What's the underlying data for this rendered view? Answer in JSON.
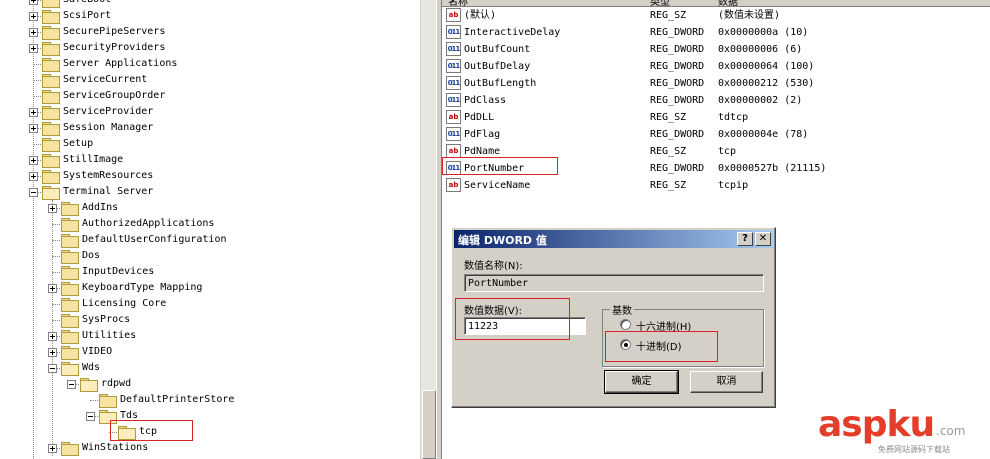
{
  "tree": {
    "nodes": [
      {
        "label": "SafeBoot",
        "expander": "plus"
      },
      {
        "label": "ScsiPort",
        "expander": "plus"
      },
      {
        "label": "SecurePipeServers",
        "expander": "plus"
      },
      {
        "label": "SecurityProviders",
        "expander": "plus"
      },
      {
        "label": "Server Applications",
        "expander": "none"
      },
      {
        "label": "ServiceCurrent",
        "expander": "none"
      },
      {
        "label": "ServiceGroupOrder",
        "expander": "none"
      },
      {
        "label": "ServiceProvider",
        "expander": "plus"
      },
      {
        "label": "Session Manager",
        "expander": "plus"
      },
      {
        "label": "Setup",
        "expander": "none"
      },
      {
        "label": "StillImage",
        "expander": "plus"
      },
      {
        "label": "SystemResources",
        "expander": "plus"
      },
      {
        "label": "Terminal Server",
        "expander": "minus"
      },
      {
        "label": "AddIns",
        "expander": "plus"
      },
      {
        "label": "AuthorizedApplications",
        "expander": "none"
      },
      {
        "label": "DefaultUserConfiguration",
        "expander": "none"
      },
      {
        "label": "Dos",
        "expander": "none"
      },
      {
        "label": "InputDevices",
        "expander": "none"
      },
      {
        "label": "KeyboardType Mapping",
        "expander": "plus"
      },
      {
        "label": "Licensing Core",
        "expander": "none"
      },
      {
        "label": "SysProcs",
        "expander": "none"
      },
      {
        "label": "Utilities",
        "expander": "plus"
      },
      {
        "label": "VIDEO",
        "expander": "plus"
      },
      {
        "label": "Wds",
        "expander": "minus"
      },
      {
        "label": "rdpwd",
        "expander": "minus"
      },
      {
        "label": "DefaultPrinterStore",
        "expander": "none"
      },
      {
        "label": "Tds",
        "expander": "minus"
      },
      {
        "label": "tcp",
        "expander": "none",
        "selected": true
      },
      {
        "label": "WinStations",
        "expander": "plus"
      }
    ]
  },
  "list": {
    "headers": {
      "name": "名称",
      "type": "类型",
      "data": "数据"
    },
    "rows": [
      {
        "icon": "string-value-icon",
        "name": "(默认)",
        "type": "REG_SZ",
        "data": "(数值未设置)"
      },
      {
        "icon": "binary-value-icon",
        "name": "InteractiveDelay",
        "type": "REG_DWORD",
        "data": "0x0000000a (10)"
      },
      {
        "icon": "binary-value-icon",
        "name": "OutBufCount",
        "type": "REG_DWORD",
        "data": "0x00000006 (6)"
      },
      {
        "icon": "binary-value-icon",
        "name": "OutBufDelay",
        "type": "REG_DWORD",
        "data": "0x00000064 (100)"
      },
      {
        "icon": "binary-value-icon",
        "name": "OutBufLength",
        "type": "REG_DWORD",
        "data": "0x00000212 (530)"
      },
      {
        "icon": "binary-value-icon",
        "name": "PdClass",
        "type": "REG_DWORD",
        "data": "0x00000002 (2)"
      },
      {
        "icon": "string-value-icon",
        "name": "PdDLL",
        "type": "REG_SZ",
        "data": "tdtcp"
      },
      {
        "icon": "binary-value-icon",
        "name": "PdFlag",
        "type": "REG_DWORD",
        "data": "0x0000004e (78)"
      },
      {
        "icon": "string-value-icon",
        "name": "PdName",
        "type": "REG_SZ",
        "data": "tcp"
      },
      {
        "icon": "binary-value-icon",
        "name": "PortNumber",
        "type": "REG_DWORD",
        "data": "0x0000527b (21115)"
      },
      {
        "icon": "string-value-icon",
        "name": "ServiceName",
        "type": "REG_SZ",
        "data": "tcpip"
      }
    ]
  },
  "dialog": {
    "title": "编辑 DWORD 值",
    "help_button": "?",
    "close_button": "✕",
    "value_name_label": "数值名称(N):",
    "value_name": "PortNumber",
    "value_data_label": "数值数据(V):",
    "value_data": "11223",
    "base_label": "基数",
    "radio_hex": "十六进制(H)",
    "radio_dec": "十进制(D)",
    "selected_base": "dec",
    "ok_label": "确定",
    "cancel_label": "取消"
  },
  "watermark": {
    "brand_asp": "asp",
    "brand_ku": "ku",
    "brand_com": ".com",
    "subtitle": "免费网站源码下载站"
  },
  "colors": {
    "annotation_red": "#d9232a",
    "title_bar": "#0a246a",
    "window_face": "#d4d0c8"
  },
  "icons": {
    "string-value-icon": "ab",
    "binary-value-icon": "011"
  }
}
